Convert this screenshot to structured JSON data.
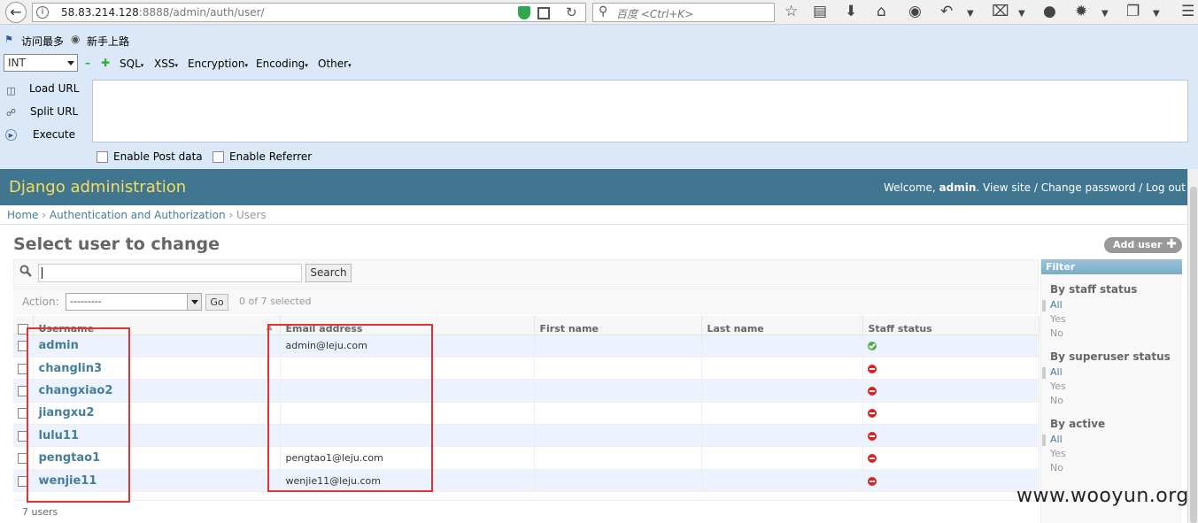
{
  "browser": {
    "url_host": "58.83.214.128",
    "url_rest": ":8888/admin/auth/user/",
    "search_placeholder": "百度 <Ctrl+K>"
  },
  "bookmarks": {
    "item1": "访问最多",
    "item2": "新手上路"
  },
  "hackbar": {
    "type_select": "INT",
    "menus": [
      "SQL",
      "XSS",
      "Encryption",
      "Encoding",
      "Other"
    ],
    "load_url": "Load URL",
    "split_url": "Split URL",
    "execute": "Execute",
    "enable_post": "Enable Post data",
    "enable_referrer": "Enable Referrer"
  },
  "header": {
    "site_title": "Django administration",
    "welcome": "Welcome, ",
    "username": "admin",
    "view_site": "View site",
    "change_password": "Change password",
    "log_out": "Log out",
    "sep": " / "
  },
  "breadcrumbs": {
    "home": "Home",
    "app": "Authentication and Authorization",
    "current": "Users",
    "sep": " › "
  },
  "page": {
    "title": "Select user to change",
    "add_button": "Add user"
  },
  "search": {
    "button": "Search",
    "value": ""
  },
  "actions": {
    "label": "Action:",
    "selected": "---------",
    "go": "Go",
    "counter": "0 of 7 selected"
  },
  "table": {
    "columns": [
      "Username",
      "Email address",
      "First name",
      "Last name",
      "Staff status"
    ],
    "rows": [
      {
        "username": "admin",
        "email": "admin@leju.com",
        "first": "",
        "last": "",
        "staff": true
      },
      {
        "username": "changlin3",
        "email": "",
        "first": "",
        "last": "",
        "staff": false
      },
      {
        "username": "changxiao2",
        "email": "",
        "first": "",
        "last": "",
        "staff": false
      },
      {
        "username": "jiangxu2",
        "email": "",
        "first": "",
        "last": "",
        "staff": false
      },
      {
        "username": "lulu11",
        "email": "",
        "first": "",
        "last": "",
        "staff": false
      },
      {
        "username": "pengtao1",
        "email": "pengtao1@leju.com",
        "first": "",
        "last": "",
        "staff": false
      },
      {
        "username": "wenjie11",
        "email": "wenjie11@leju.com",
        "first": "",
        "last": "",
        "staff": false
      }
    ],
    "footer": "7 users"
  },
  "filter": {
    "title": "Filter",
    "sections": [
      {
        "title": "By staff status",
        "options": [
          "All",
          "Yes",
          "No"
        ]
      },
      {
        "title": "By superuser status",
        "options": [
          "All",
          "Yes",
          "No"
        ]
      },
      {
        "title": "By active",
        "options": [
          "All",
          "Yes",
          "No"
        ]
      }
    ]
  },
  "watermark": "www.wooyun.org",
  "colors": {
    "header_bg": "#417690",
    "header_title": "#f5dd5d",
    "link": "#447e9b",
    "annotation_red": "#e53333"
  }
}
